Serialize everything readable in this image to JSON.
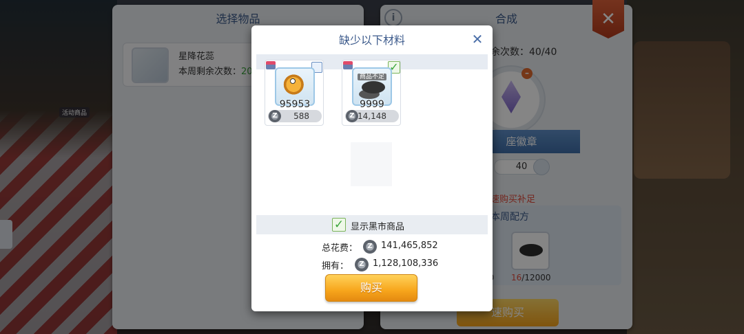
{
  "background": {
    "left_panel": {
      "title": "选择物品",
      "item_name": "星降花蕊",
      "item_remain_label": "本周剩余次数：",
      "item_remain_value": "20"
    },
    "right_panel": {
      "title": "合成",
      "remain": "余次数：40/40",
      "ribbon_text": "座徽章",
      "count": "40",
      "quick_buy_note": "速购买补足",
      "recipe_title": "本周配方",
      "recipe_left_qty": "00",
      "recipe_qty_have": "16",
      "recipe_qty_need": "/12000",
      "quick_buy_button": "速购买"
    },
    "scene_labels": [
      "活动商品"
    ]
  },
  "modal": {
    "title": "缺少以下材料",
    "close_icon": "close-icon",
    "materials": [
      {
        "quantity": "95953",
        "price": "588",
        "checked": false,
        "tag": ""
      },
      {
        "quantity": "9999",
        "price": "14,148",
        "checked": true,
        "tag": "商品不足"
      }
    ],
    "show_black_market_label": "显示黑市商品",
    "show_black_market_checked": true,
    "total_cost_label": "总花费：",
    "total_cost_value": "141,465,852",
    "owned_label": "拥有：",
    "owned_value": "1,128,108,336",
    "buy_button": "购买"
  },
  "colors": {
    "title_blue": "#3d5b8c",
    "buy_orange": "#f7a51c",
    "check_green": "#3aa53a",
    "warning_red": "#e04a3a"
  }
}
